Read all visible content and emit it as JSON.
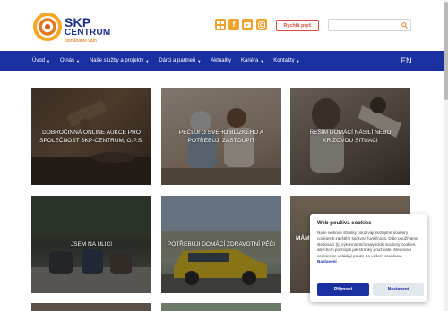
{
  "header": {
    "logo_title": "SKP",
    "logo_title2": "CENTRUM",
    "logo_tagline": "pomáháme vám",
    "social_icons": [
      "grid-icon",
      "facebook-icon",
      "youtube-icon",
      "instagram-icon"
    ],
    "quick_help_label": "Rychlá pryč",
    "search_placeholder": ""
  },
  "nav": {
    "items": [
      {
        "label": "Úvod",
        "caret": true
      },
      {
        "label": "O nás",
        "caret": true
      },
      {
        "label": "Naše služby a projekty",
        "caret": true
      },
      {
        "label": "Dárci a partneři",
        "caret": true
      },
      {
        "label": "Aktuality",
        "caret": false
      },
      {
        "label": "Kariéra",
        "caret": true
      },
      {
        "label": "Kontakty",
        "caret": true
      }
    ],
    "language": "EN"
  },
  "tiles": [
    {
      "label": "DOBROČINNÁ ONLINE AUKCE PRO SPOLEČNOST SKP-CENTRUM, O.P.S."
    },
    {
      "label": "PEČUJI O SVÉHO BLÍZKÉHO A POTŘEBUJI ZASTOUPIT"
    },
    {
      "label": "ŘEŠÍM DOMÁCÍ NÁSILÍ NEBO KRIZOVOU SITUACI"
    },
    {
      "label": "JSEM NA ULICI"
    },
    {
      "label": "POTŘEBUJI DOMÁCÍ ZDRAVOTNÍ PÉČI"
    },
    {
      "label": "MÁM"
    }
  ],
  "cookie": {
    "title": "Web používá cookies",
    "text": "Naše webové stránky používají nezbytné soubory cookies k zajištění správné funkčnosti. Dále používáme sledovací (tj. výkonnostní/analytické) soubory cookies, abychom pochopili jak stránky používáte. Sledovací cookies se ukládají pouze po vašem souhlasu.",
    "link": "Nastavení",
    "accept_label": "Přijmout",
    "settings_label": "Nastavení"
  },
  "colors": {
    "brand_blue": "#1a2fa0",
    "brand_orange": "#f0a22e",
    "quick_red": "#d94b3d"
  }
}
